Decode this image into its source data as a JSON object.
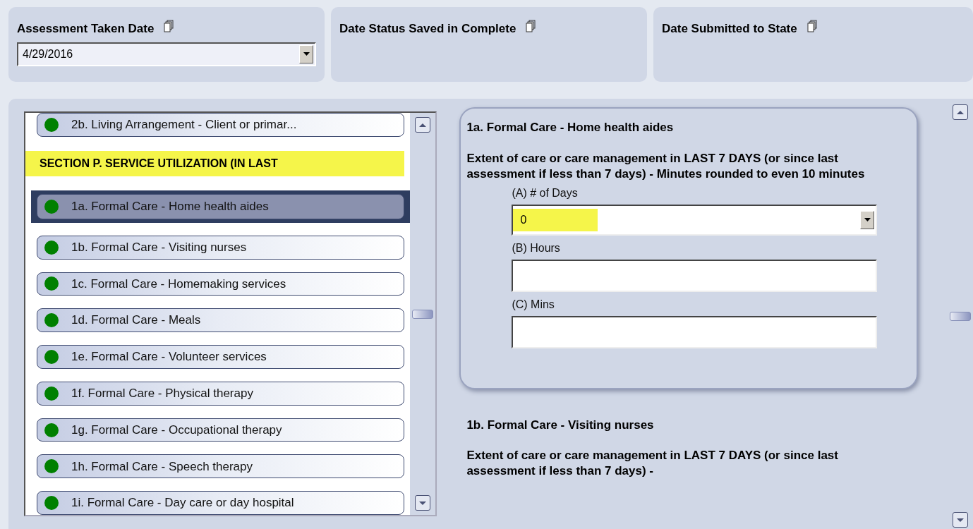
{
  "header_fields": [
    {
      "label": "Assessment Taken Date",
      "value": "4/29/2016",
      "kind": "dropdown"
    },
    {
      "label": "Date Status Saved in Complete",
      "kind": "readonly"
    },
    {
      "label": "Date Submitted to State",
      "kind": "readonly"
    }
  ],
  "navigator": {
    "items": [
      {
        "kind": "item",
        "label": "2b. Living Arrangement - Client or primar...",
        "selected": false
      },
      {
        "kind": "section",
        "label": "SECTION P. SERVICE UTILIZATION (IN LAST",
        "highlighted": true
      },
      {
        "kind": "item",
        "label": "1a. Formal Care - Home health aides",
        "selected": true
      },
      {
        "kind": "item",
        "label": "1b. Formal Care - Visiting nurses",
        "selected": false
      },
      {
        "kind": "item",
        "label": "1c. Formal Care - Homemaking services",
        "selected": false
      },
      {
        "kind": "item",
        "label": "1d. Formal Care - Meals",
        "selected": false
      },
      {
        "kind": "item",
        "label": "1e. Formal Care - Volunteer services",
        "selected": false
      },
      {
        "kind": "item",
        "label": "1f. Formal Care - Physical therapy",
        "selected": false
      },
      {
        "kind": "item",
        "label": "1g. Formal Care - Occupational therapy",
        "selected": false
      },
      {
        "kind": "item",
        "label": "1h. Formal Care - Speech therapy",
        "selected": false
      },
      {
        "kind": "item",
        "label": "1i. Formal Care - Day care or day hospital",
        "selected": false
      }
    ]
  },
  "questions": [
    {
      "title": "1a. Formal Care - Home health aides",
      "prompt": "Extent of care or care management in LAST 7 DAYS (or since last assessment if less than 7 days) - Minutes rounded to even 10 minutes",
      "active": true,
      "fields": [
        {
          "label": "(A) # of Days",
          "kind": "dropdown",
          "value": "0",
          "highlighted": true
        },
        {
          "label": "(B) Hours",
          "kind": "text"
        },
        {
          "label": "(C) Mins",
          "kind": "text"
        }
      ]
    },
    {
      "title": "1b. Formal Care - Visiting nurses",
      "prompt": "Extent of care or care management in LAST 7 DAYS (or since last assessment if less than 7 days) -",
      "active": false
    }
  ]
}
